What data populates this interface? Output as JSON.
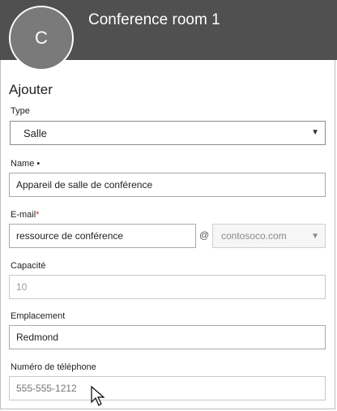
{
  "header": {
    "avatar_letter": "C",
    "title": "Conference room 1"
  },
  "form": {
    "section_title": "Ajouter",
    "type": {
      "label": "Type",
      "value": "Salle"
    },
    "name": {
      "label": "Name",
      "required_mark": "•",
      "value": "Appareil de salle de conférence"
    },
    "email": {
      "label": "E-mail",
      "required_mark": "*",
      "value": "ressource de conférence",
      "at": "@",
      "domain": "contosoco.com"
    },
    "capacity": {
      "label": "Capacité",
      "value": "10"
    },
    "location": {
      "label": "Emplacement",
      "value": "Redmond"
    },
    "phone": {
      "label": "Numéro de téléphone",
      "placeholder": "555-555-1212"
    }
  }
}
